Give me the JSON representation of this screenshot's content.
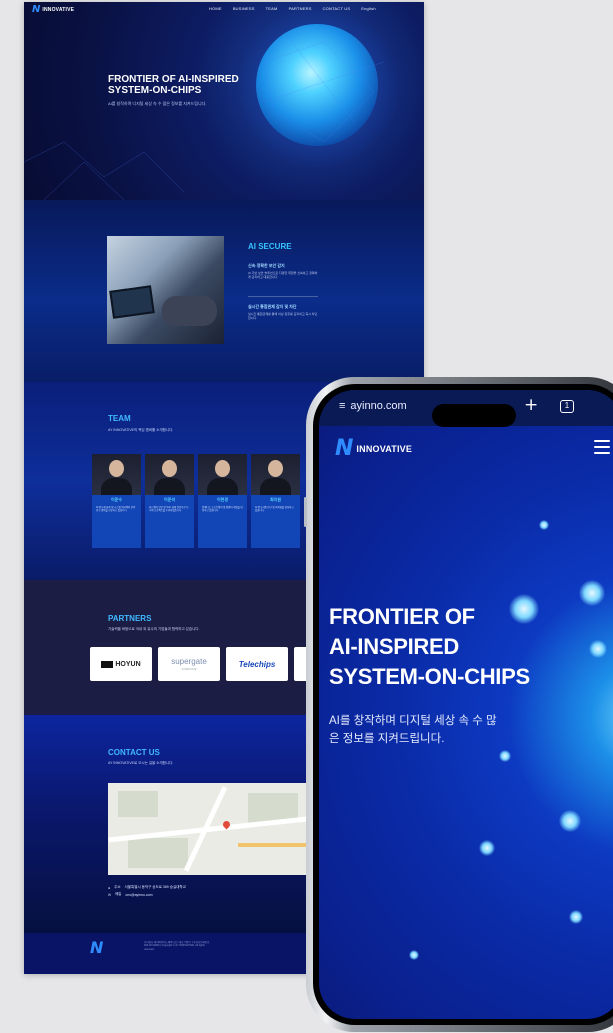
{
  "desktop": {
    "brand": {
      "mark": "N",
      "name": "INNOVATIVE"
    },
    "nav": [
      "HOME",
      "BUSINESS",
      "TEAM",
      "PARTNERS",
      "CONTACT US",
      "English"
    ],
    "hero": {
      "title": "FRONTIER OF AI-INSPIRED SYSTEM-ON-CHIPS",
      "subtitle": "AI를 창작하며 디지털 세상 속 수 많은 정보를 지켜드립니다."
    },
    "ai_secure": {
      "title": "AI SECURE",
      "item1_heading": "신속·정확한 보안 감지",
      "item1_text": "AI 기반 보안 솔루션으로 다양한 위협을 신속하고 정확하게 감지하고 대응합니다.",
      "item2_heading": "실시간 통합관제 감지 및 차단",
      "item2_text": "실시간 통합관제를 통해 이상 징후를 감지하고 즉시 차단합니다."
    },
    "team": {
      "title": "TEAM",
      "subtitle": "AY INNOVATIVE의 핵심 멤버를 소개합니다.",
      "members": [
        {
          "name": "이준수",
          "desc": "AI 반도체 설계 및 시스템 아키텍처 분야 연구 경력을 보유하고 있습니다."
        },
        {
          "name": "이준석",
          "desc": "하드웨어 보안 및 SoC 설계 전문가로 다수의 프로젝트를 수행하였습니다."
        },
        {
          "name": "이현경",
          "desc": "임베디드 소프트웨어 및 펌웨어 개발을 담당하고 있습니다."
        },
        {
          "name": "최지원",
          "desc": "AI 알고리즘 연구 및 최적화를 담당하고 있습니다."
        }
      ]
    },
    "partners": {
      "title": "PARTNERS",
      "subtitle": "기술력을 바탕으로 국내 외 유수의 기업들과 협력하고 있습니다.",
      "logos": [
        {
          "name": "HOYUN",
          "caption": ""
        },
        {
          "name": "supergate",
          "caption": "SUPERGATE"
        },
        {
          "name": "Telechips",
          "caption": ""
        }
      ]
    },
    "contact": {
      "title": "CONTACT US",
      "subtitle": "AY INNOVATIVE로 오시는 길을 소개합니다.",
      "address_label": "주소",
      "address": "서울특별시 동작구 상도로 369 숭실대학교",
      "email_label": "메일",
      "email": "ceo@ayinno.com"
    },
    "footer": {
      "text": "주식회사 에이와이이노베이티브 | 대표 이준수 | 사업자등록번호 000-00-00000 | Copyright © AY INNOVATIVE. All rights reserved."
    }
  },
  "mobile": {
    "url": "ayinno.com",
    "tab_count": "1",
    "brand": {
      "mark": "N",
      "name": "INNOVATIVE"
    },
    "hero_title_lines": [
      "FRONTIER OF",
      "AI-INSPIRED",
      "SYSTEM-ON-CHIPS"
    ],
    "hero_subtitle": "AI를 창작하며 디지털 세상 속 수 많은 정보를 지켜드립니다."
  },
  "colors": {
    "accent": "#37c4ff",
    "navy": "#0a1a7a",
    "brand_blue": "#2f8cff"
  },
  "icons": [
    "hamburger-menu-icon",
    "plus-icon",
    "tabs-icon",
    "site-settings-icon",
    "location-icon",
    "mail-icon"
  ]
}
